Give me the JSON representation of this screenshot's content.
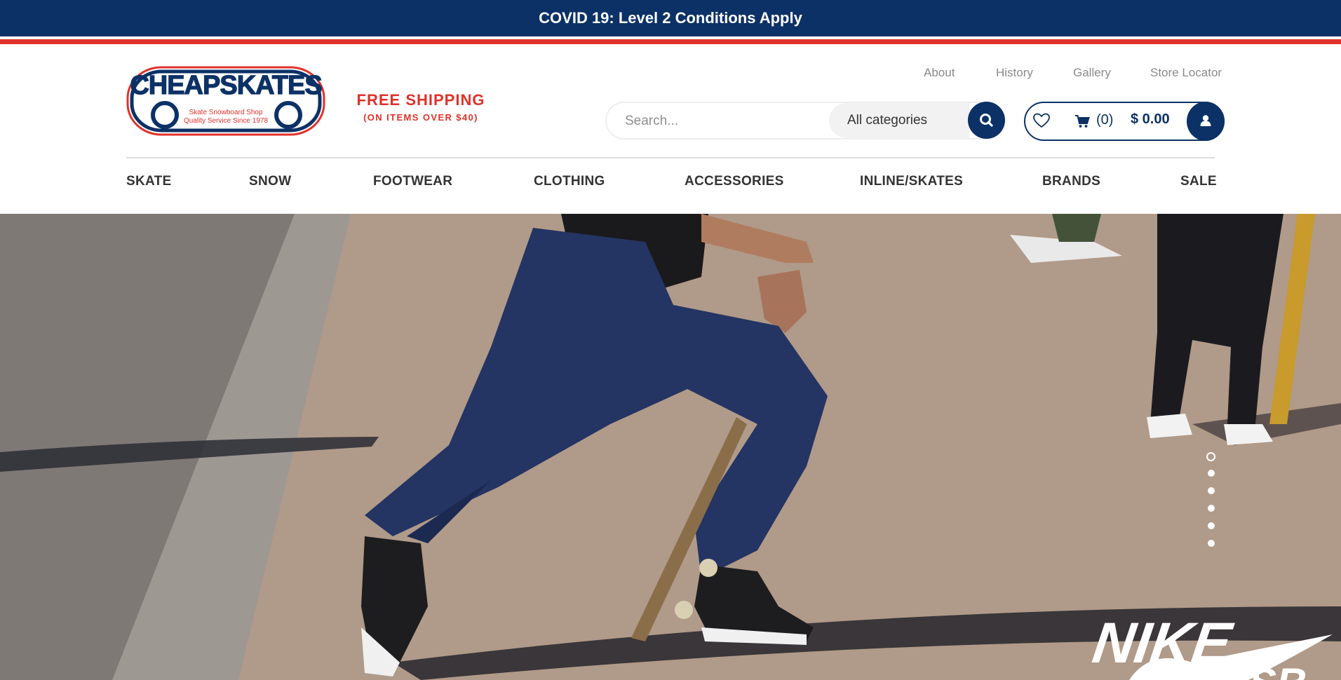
{
  "announcement": {
    "text": "COVID 19: Level 2 Conditions Apply"
  },
  "brand": {
    "logo_text": "CHEAPSKATES",
    "logo_tagline_1": "Skate Snowboard Shop",
    "logo_tagline_2": "Quality Service Since 1978",
    "navy": "#0c3166",
    "red": "#e0322a"
  },
  "promo": {
    "line1": "FREE SHIPPING",
    "line2": "(ON ITEMS OVER $40)"
  },
  "top_links": [
    {
      "label": "About"
    },
    {
      "label": "History"
    },
    {
      "label": "Gallery"
    },
    {
      "label": "Store Locator"
    }
  ],
  "search": {
    "placeholder": "Search...",
    "value": "",
    "category_selected": "All categories",
    "button_icon": "search-icon"
  },
  "cart": {
    "wishlist_icon": "heart-icon",
    "cart_icon": "cart-icon",
    "count_text": "(0)",
    "total_text": "$ 0.00",
    "user_icon": "user-icon"
  },
  "main_nav": [
    {
      "label": "SKATE"
    },
    {
      "label": "SNOW"
    },
    {
      "label": "FOOTWEAR"
    },
    {
      "label": "CLOTHING"
    },
    {
      "label": "ACCESSORIES"
    },
    {
      "label": "INLINE/SKATES"
    },
    {
      "label": "BRANDS"
    },
    {
      "label": "SALE"
    }
  ],
  "hero": {
    "brand_text": "NIKE",
    "brand_sub": "SB",
    "slides_total": 6,
    "active_slide": 1
  }
}
